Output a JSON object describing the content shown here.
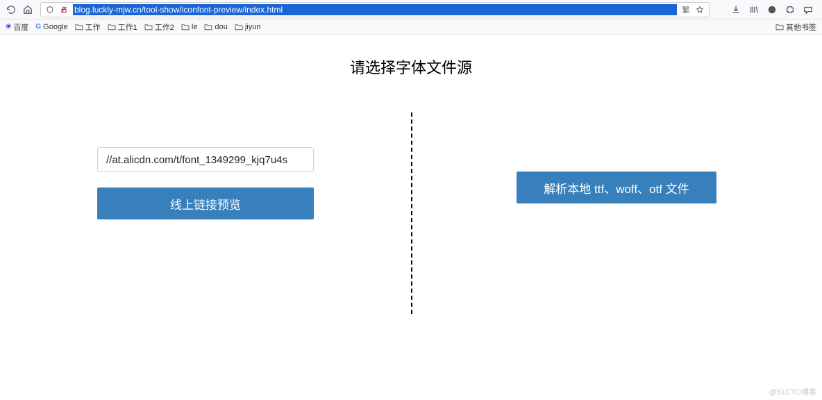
{
  "browser": {
    "url": "blog.luckly-mjw.cn/tool-show/iconfont-preview/index.html",
    "bookmarks": [
      {
        "label": "百度",
        "icon": "baidu"
      },
      {
        "label": "Google",
        "icon": "google"
      },
      {
        "label": "工作",
        "icon": "folder"
      },
      {
        "label": "工作1",
        "icon": "folder"
      },
      {
        "label": "工作2",
        "icon": "folder"
      },
      {
        "label": "le",
        "icon": "folder"
      },
      {
        "label": "dou",
        "icon": "folder"
      },
      {
        "label": "jiyun",
        "icon": "folder"
      }
    ],
    "other_bookmarks_label": "其他书签"
  },
  "page": {
    "title": "请选择字体文件源",
    "input_value": "//at.alicdn.com/t/font_1349299_kjq7u4s",
    "preview_button": "线上链接预览",
    "parse_button": "解析本地 ttf、woff、otf 文件"
  },
  "watermark": "@51CTO博客"
}
